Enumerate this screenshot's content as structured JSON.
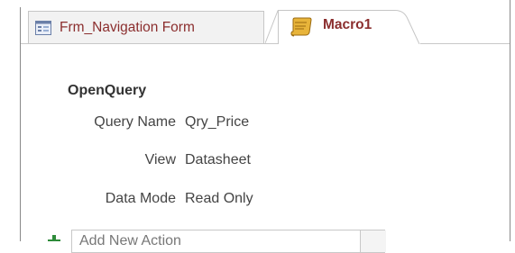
{
  "tabs": [
    {
      "label": "Frm_Navigation Form",
      "icon": "form-icon",
      "active": false
    },
    {
      "label": "Macro1",
      "icon": "macro-scroll-icon",
      "active": true
    }
  ],
  "macro": {
    "action": "OpenQuery",
    "arguments": [
      {
        "label": "Query Name",
        "value": "Qry_Price"
      },
      {
        "label": "View",
        "value": "Datasheet"
      },
      {
        "label": "Data Mode",
        "value": "Read Only"
      }
    ],
    "add_action_placeholder": "Add New Action"
  },
  "colors": {
    "tab_text": "#8b2e2e",
    "add_plus": "#2e8b3a",
    "border": "#c8c8c8"
  }
}
